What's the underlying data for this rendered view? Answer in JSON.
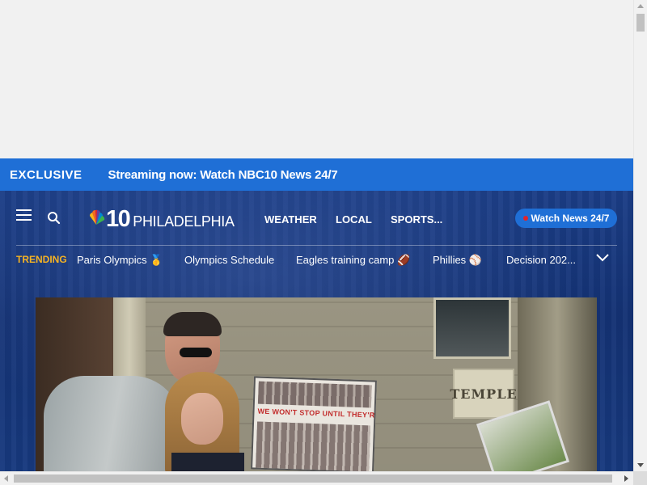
{
  "exclusive_bar": {
    "label": "EXCLUSIVE",
    "text": "Streaming now: Watch NBC10 News 24/7"
  },
  "header": {
    "logo_number": "10",
    "logo_city": "PHILADELPHIA",
    "nav": {
      "weather": "WEATHER",
      "local": "LOCAL",
      "sports": "SPORTS..."
    },
    "watch_button": "Watch News 24/7"
  },
  "trending": {
    "label": "TRENDING",
    "items": [
      {
        "label": "Paris Olympics 🥇"
      },
      {
        "label": "Olympics Schedule"
      },
      {
        "label": "Eagles training camp 🏈"
      },
      {
        "label": "Phillies ⚾"
      },
      {
        "label": "Decision 202..."
      }
    ]
  },
  "hero": {
    "sign_text": "TEMPLE",
    "poster_text": "WE WON'T STOP UNTIL THEY'RE ALL BACK"
  },
  "colors": {
    "exclusive_bg": "#1f6fd6",
    "masthead_bg": "#17397e",
    "trending_label": "#f5b323",
    "live_dot": "#e0242b"
  }
}
